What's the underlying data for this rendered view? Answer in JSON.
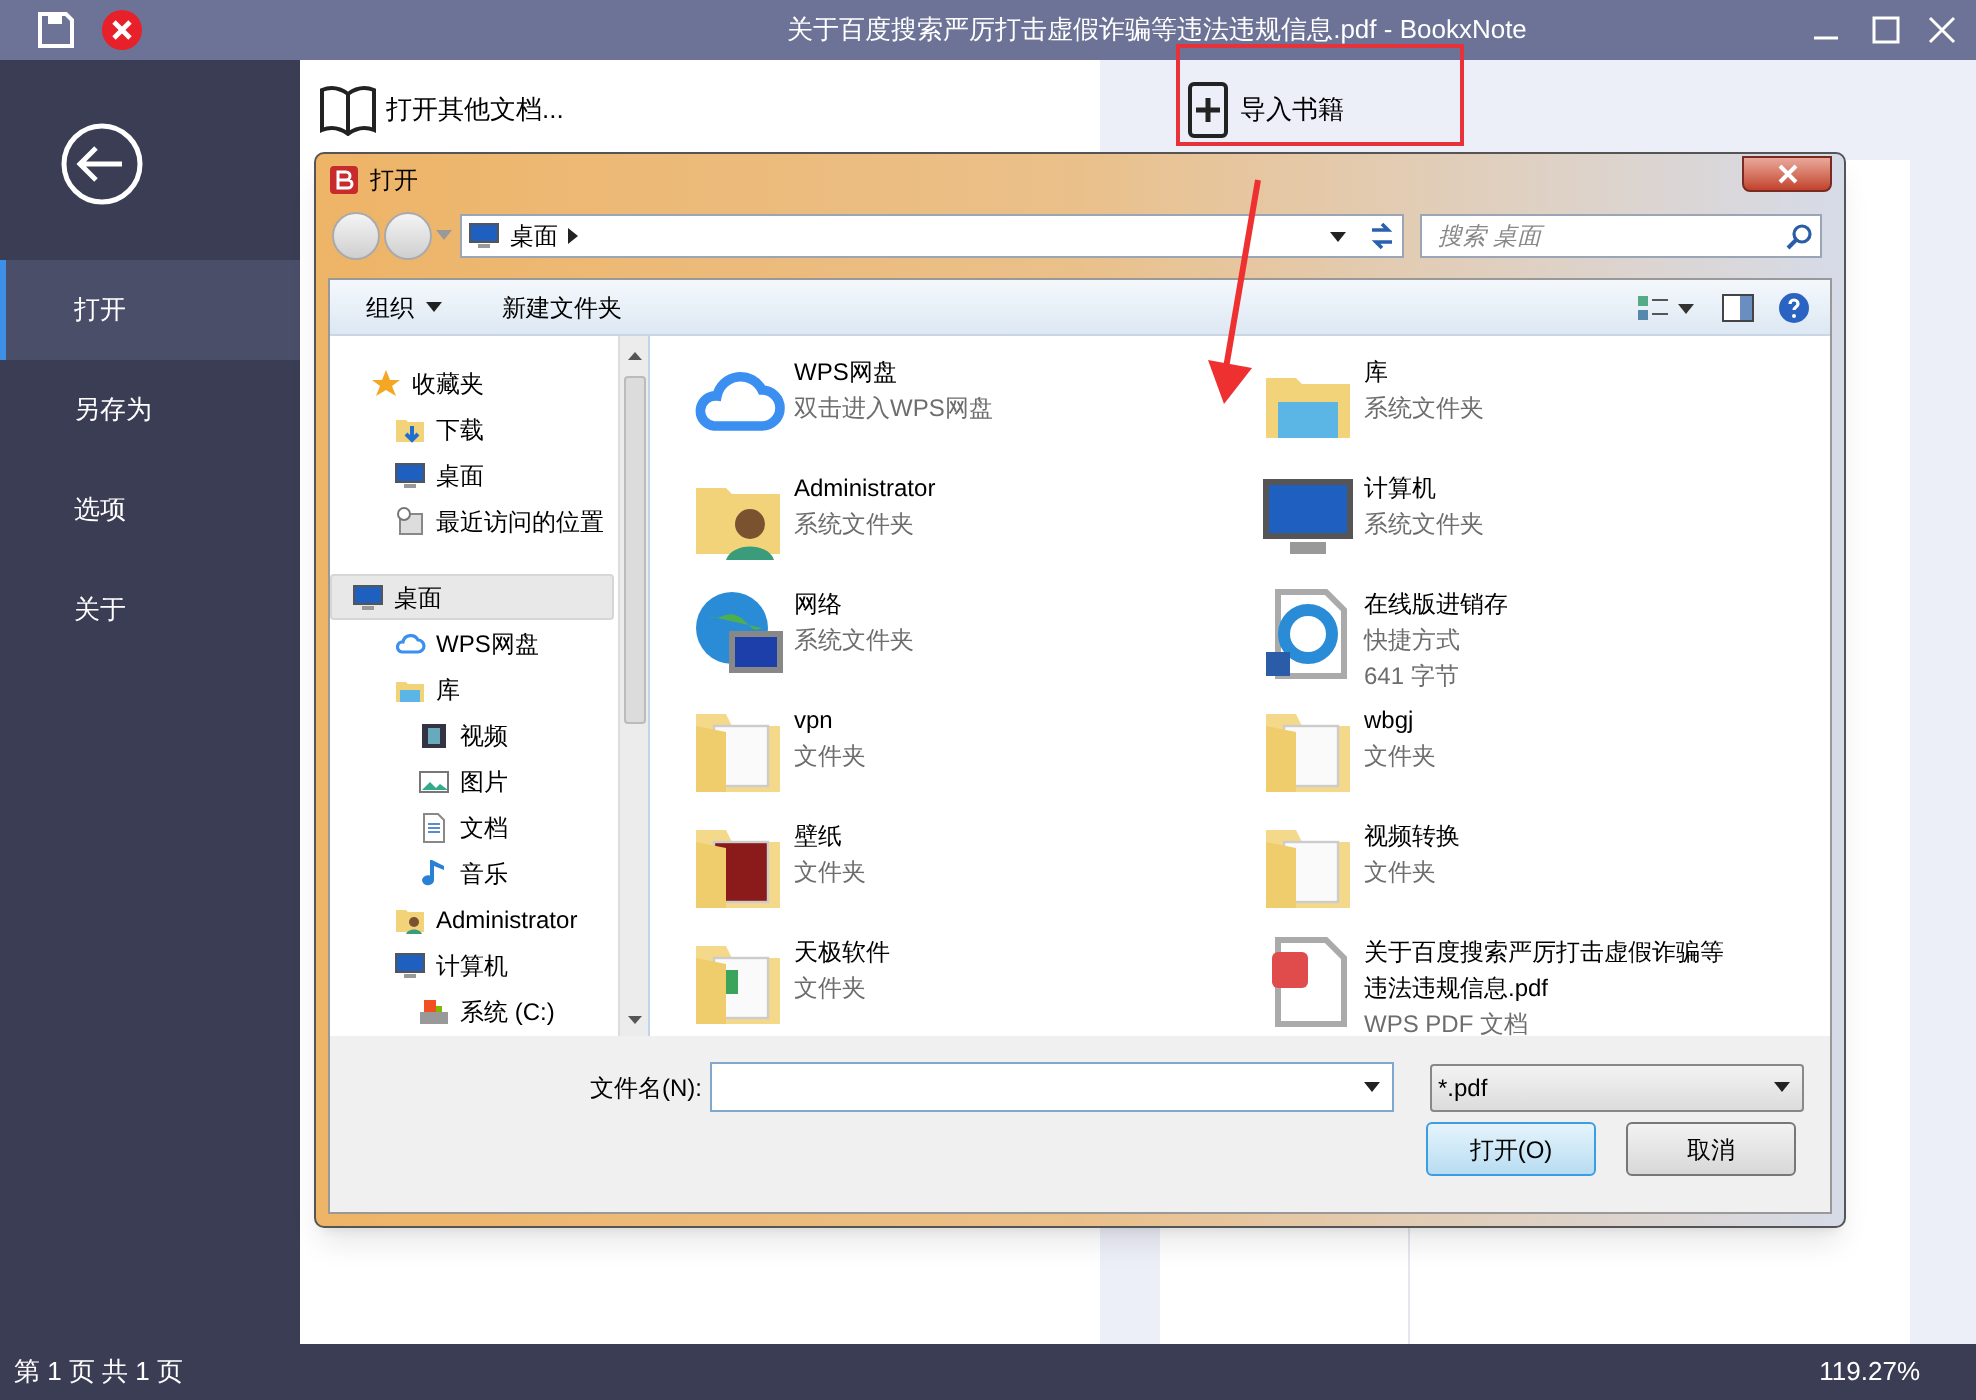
{
  "window": {
    "title": "关于百度搜索严厉打击虚假诈骗等违法违规信息.pdf - BookxNote"
  },
  "sidebar": {
    "items": [
      {
        "label": "打开",
        "selected": true
      },
      {
        "label": "另存为",
        "selected": false
      },
      {
        "label": "选项",
        "selected": false
      },
      {
        "label": "关于",
        "selected": false
      }
    ]
  },
  "toolbar": {
    "open_other": "打开其他文档...",
    "import": "导入书籍"
  },
  "dialog": {
    "title": "打开",
    "address": "桌面",
    "search": {
      "placeholder": "搜索 桌面"
    },
    "organize": "组织",
    "new_folder": "新建文件夹",
    "nav": [
      {
        "label": "收藏夹",
        "kind": "star",
        "selected": false,
        "children": [
          {
            "label": "下载",
            "kind": "download",
            "selected": false
          },
          {
            "label": "桌面",
            "kind": "desktop",
            "selected": false
          },
          {
            "label": "最近访问的位置",
            "kind": "recent",
            "selected": false
          }
        ]
      },
      {
        "label": "桌面",
        "kind": "desktop",
        "selected": true,
        "children": [
          {
            "label": "WPS网盘",
            "kind": "cloud",
            "selected": false
          },
          {
            "label": "库",
            "kind": "library",
            "selected": false,
            "children": [
              {
                "label": "视频",
                "kind": "video",
                "selected": false
              },
              {
                "label": "图片",
                "kind": "picture",
                "selected": false
              },
              {
                "label": "文档",
                "kind": "document",
                "selected": false
              },
              {
                "label": "音乐",
                "kind": "music",
                "selected": false
              }
            ]
          },
          {
            "label": "Administrator",
            "kind": "user",
            "selected": false
          },
          {
            "label": "计算机",
            "kind": "computer",
            "selected": false,
            "children": [
              {
                "label": "系统 (C:)",
                "kind": "drive",
                "selected": false
              }
            ]
          }
        ]
      }
    ],
    "files": [
      {
        "name": "WPS网盘",
        "kind": "cloud",
        "details": [
          "双击进入WPS网盘"
        ]
      },
      {
        "name": "库",
        "kind": "library",
        "details": [
          "系统文件夹"
        ]
      },
      {
        "name": "Administrator",
        "kind": "user",
        "details": [
          "系统文件夹"
        ]
      },
      {
        "name": "计算机",
        "kind": "computer",
        "details": [
          "系统文件夹"
        ]
      },
      {
        "name": "网络",
        "kind": "network",
        "details": [
          "系统文件夹"
        ]
      },
      {
        "name": "在线版进销存",
        "kind": "shortcut",
        "details": [
          "快捷方式",
          "641 字节"
        ]
      },
      {
        "name": "vpn",
        "kind": "folder",
        "details": [
          "文件夹"
        ]
      },
      {
        "name": "wbgj",
        "kind": "folder",
        "details": [
          "文件夹"
        ]
      },
      {
        "name": "壁纸",
        "kind": "photo-folder",
        "details": [
          "文件夹"
        ]
      },
      {
        "name": "视频转换",
        "kind": "folder",
        "details": [
          "文件夹"
        ]
      },
      {
        "name": "天极软件",
        "kind": "sheet-folder",
        "details": [
          "文件夹"
        ]
      },
      {
        "name": "关于百度搜索严厉打击虚假诈骗等违法违规信息.pdf",
        "kind": "pdf",
        "details": [
          "WPS PDF 文档"
        ]
      }
    ],
    "filename": {
      "label": "文件名(N):"
    },
    "filter": "*.pdf",
    "buttons": [
      {
        "label": "打开(O)",
        "default": true
      },
      {
        "label": "取消",
        "default": false
      }
    ]
  },
  "status_bar": {
    "page": "第 1 页 共 1 页",
    "zoom": "119.27%"
  }
}
